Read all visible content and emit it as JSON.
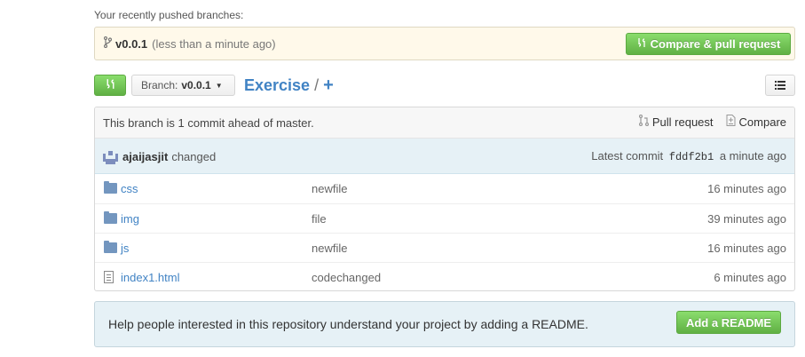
{
  "recent": {
    "label": "Your recently pushed branches:",
    "branch_name": "v0.0.1",
    "branch_time": "(less than a minute ago)",
    "compare_button": "Compare & pull request"
  },
  "toolbar": {
    "branch_label": "Branch:",
    "branch_value": "v0.0.1",
    "repo_name": "Exercise",
    "separator": "/",
    "add_symbol": "+"
  },
  "ahead_bar": {
    "message": "This branch is 1 commit ahead of master.",
    "pull_request": "Pull request",
    "compare": "Compare"
  },
  "commit": {
    "author": "ajaijasjit",
    "verb": "changed",
    "latest_label": "Latest commit",
    "sha": "fddf2b1",
    "time": "a minute ago"
  },
  "files": [
    {
      "name": "css",
      "type": "folder",
      "message": "newfile",
      "age": "16 minutes ago"
    },
    {
      "name": "img",
      "type": "folder",
      "message": "file",
      "age": "39 minutes ago"
    },
    {
      "name": "js",
      "type": "folder",
      "message": "newfile",
      "age": "16 minutes ago"
    },
    {
      "name": "index1.html",
      "type": "file",
      "message": "codechanged",
      "age": "6 minutes ago"
    }
  ],
  "readme": {
    "message": "Help people interested in this repository understand your project by adding a README.",
    "button": "Add a README"
  },
  "colors": {
    "accent_green": "#6cc644",
    "link_blue": "#4183c4",
    "notice_bg": "#fff9ea",
    "info_bg": "#e6f1f6"
  },
  "icons": {
    "branch": "git-branch-icon",
    "compare": "git-compare-icon",
    "pull_request": "git-pull-request-icon",
    "list": "list-icon",
    "folder": "folder-icon",
    "file": "file-icon"
  }
}
